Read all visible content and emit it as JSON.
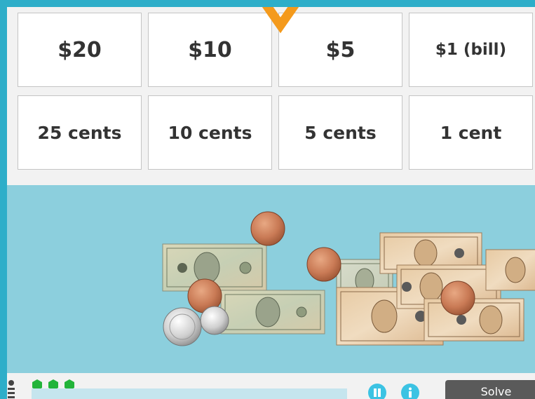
{
  "tiles": {
    "row1": [
      "$20",
      "$10",
      "$5",
      "$1 (bill)"
    ],
    "row2": [
      "25 cents",
      "10 cents",
      "5 cents",
      "1 cent"
    ]
  },
  "bottom_bar": {
    "solve_label": "Solve",
    "lives_remaining": 3
  },
  "colors": {
    "frame": "#2eaec9",
    "money_area": "#8ccfdd",
    "selector_arrow": "#f49a1c",
    "life_gem": "#22b43a"
  },
  "icons": [
    "selector-arrow-icon",
    "menu-icon",
    "pause-icon",
    "info-icon",
    "life-gem-icon"
  ]
}
